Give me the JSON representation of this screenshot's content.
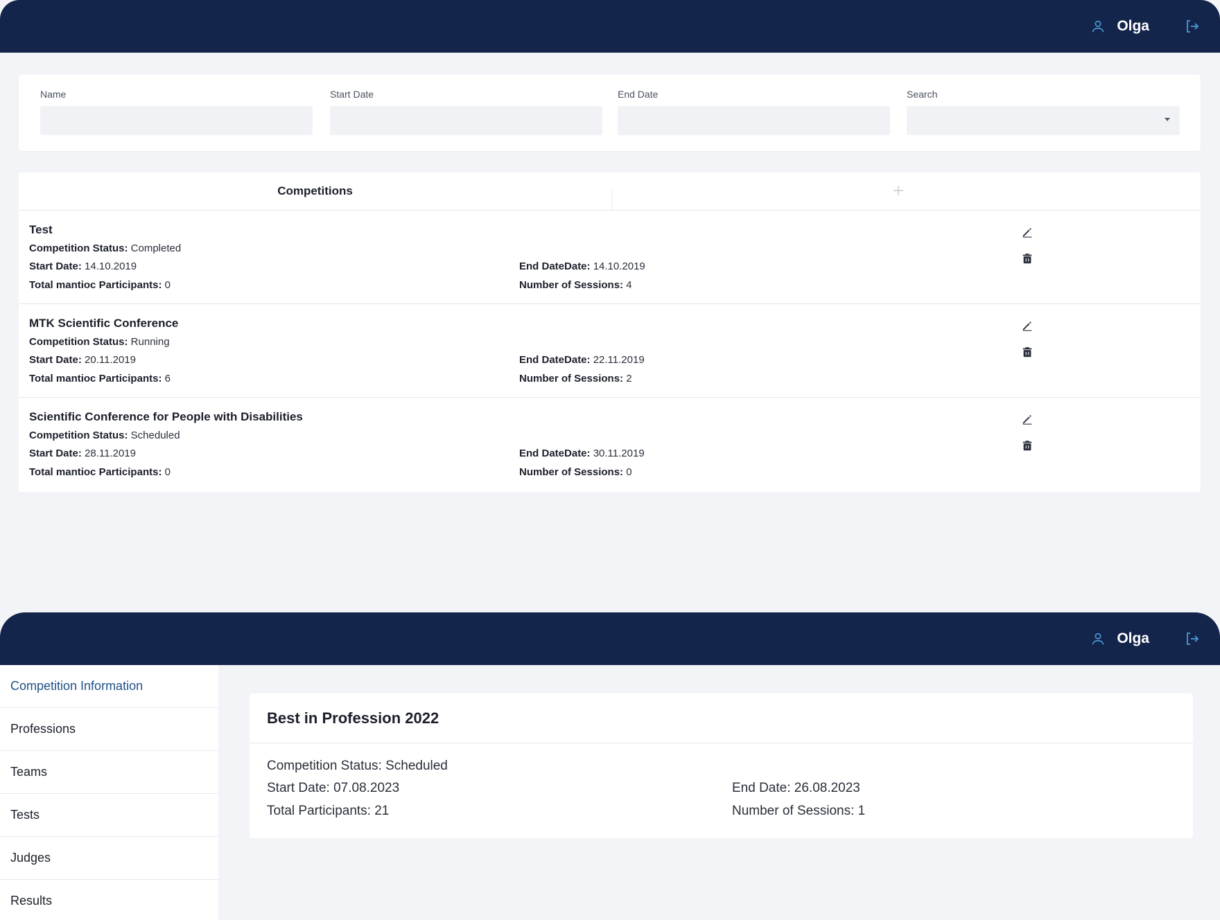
{
  "user": {
    "name": "Olga"
  },
  "filters": {
    "name_label": "Name",
    "start_label": "Start Date",
    "end_label": "End Date",
    "search_label": "Search"
  },
  "competitions": {
    "title": "Competitions",
    "rows": [
      {
        "name": "Test",
        "status_label": "Competition Status:",
        "status": "Completed",
        "start_label": "Start Date:",
        "start": "14.10.2019",
        "end_label": "End Date",
        "end_label2": "Date:",
        "end": "14.10.2019",
        "total_label": "Total",
        "total_label_mid": "mantioc",
        "total_label_end": "Participants:",
        "total": "0",
        "sessions_label": "Number of Sessions:",
        "sessions": "4"
      },
      {
        "name": "MTK Scientific Conference",
        "status_label": "Competition Status:",
        "status": "Running",
        "start_label": "Start Date:",
        "start": "20.11.2019",
        "end_label": "End Date",
        "end_label2": "Date:",
        "end": "22.11.2019",
        "total_label": "Total",
        "total_label_mid": "mantioc",
        "total_label_end": "Participants:",
        "total": "6",
        "sessions_label": "Number of Sessions:",
        "sessions": "2"
      },
      {
        "name": "Scientific Conference for People with Disabilities",
        "status_label": "Competition Status:",
        "status": "Scheduled",
        "start_label": "Start Date:",
        "start": "28.11.2019",
        "end_label": "End Date",
        "end_label2": "Date:",
        "end": "30.11.2019",
        "total_label": "Total",
        "total_label_mid": "mantioc",
        "total_label_end": "Participants:",
        "total": "0",
        "sessions_label": "Number of Sessions:",
        "sessions": "0"
      }
    ]
  },
  "sidebar": {
    "items": [
      {
        "label": "Competition Information"
      },
      {
        "label": "Professions"
      },
      {
        "label": "Teams"
      },
      {
        "label": "Tests"
      },
      {
        "label": "Judges"
      },
      {
        "label": "Results"
      }
    ]
  },
  "detail": {
    "title": "Best in Profession 2022",
    "status": "Competition Status: Scheduled",
    "start": "Start Date: 07.08.2023",
    "end": "End Date: 26.08.2023",
    "total": "Total Participants: 21",
    "sessions": "Number of Sessions: 1"
  },
  "colors": {
    "topbar": "#13254a",
    "accent": "#4a9ad8",
    "active_nav": "#1e4f87",
    "background": "#f3f4f7"
  },
  "icons": [
    "user-icon",
    "logout-icon",
    "add-icon",
    "edit-icon",
    "delete-icon",
    "dropdown-caret-icon"
  ]
}
